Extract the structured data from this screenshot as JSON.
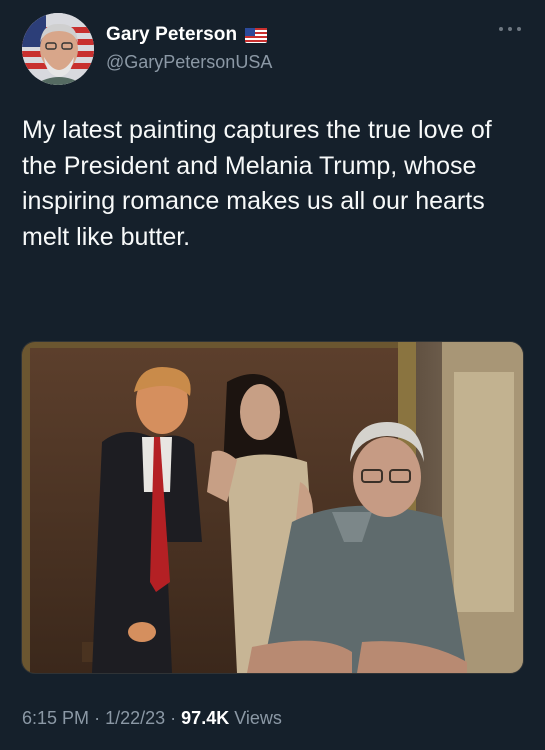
{
  "user": {
    "display_name": "Gary Peterson",
    "handle": "@GaryPetersonUSA",
    "badge_icon": "us-flag-icon"
  },
  "tweet": {
    "text": "My latest painting captures the true love of the President and Melania Trump, whose inspiring romance makes us all our hearts melt like butter."
  },
  "meta": {
    "time": "6:15 PM",
    "separator": "·",
    "date": "1/22/23",
    "views_count": "97.4K",
    "views_label": "Views"
  },
  "colors": {
    "background": "#15202b",
    "secondary_text": "#8b98a5",
    "primary_text": "#ffffff"
  }
}
